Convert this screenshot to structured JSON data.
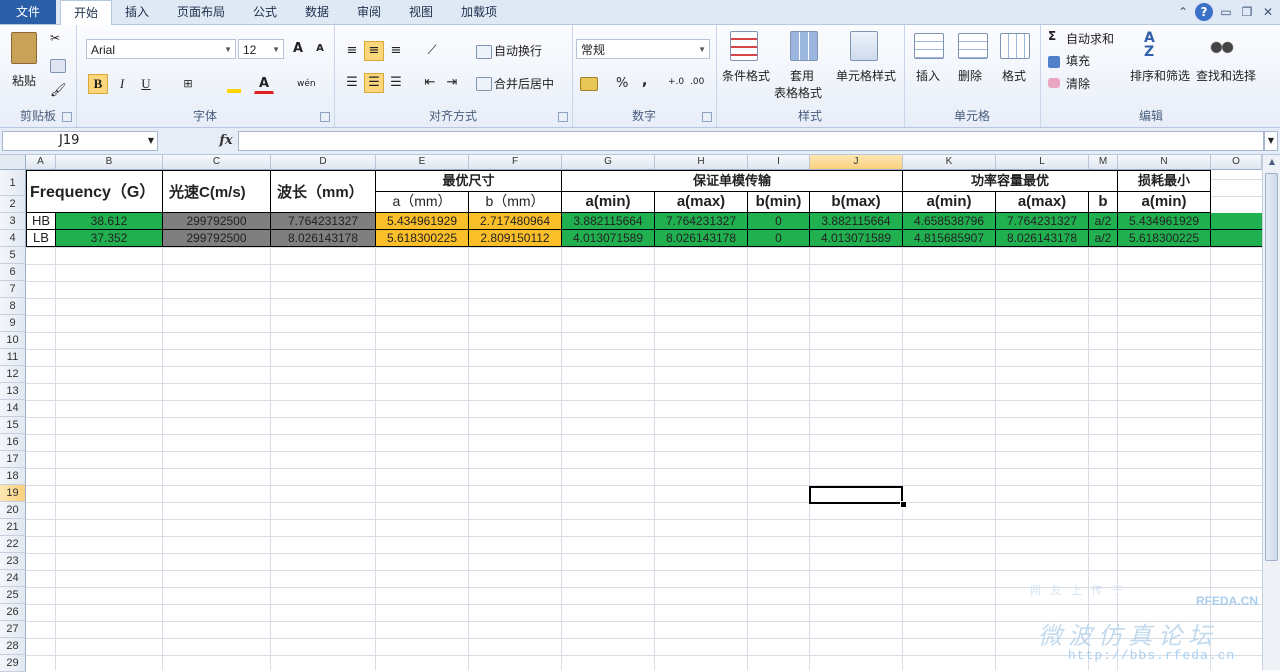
{
  "tabs": [
    "文件",
    "开始",
    "插入",
    "页面布局",
    "公式",
    "数据",
    "审阅",
    "视图",
    "加载项"
  ],
  "ribbon": {
    "clipboard": {
      "paste": "粘贴",
      "label": "剪贴板"
    },
    "font": {
      "name": "Arial",
      "size": "12",
      "label": "字体",
      "bold": "B",
      "italic": "I",
      "underline": "U",
      "grow": "A",
      "shrink": "A",
      "fontcolor": "A",
      "phonetic": "wén"
    },
    "alignment": {
      "wrap": "自动换行",
      "merge": "合并后居中",
      "label": "对齐方式"
    },
    "number": {
      "format": "常规",
      "percent": "%",
      "comma": ",",
      "inc": "+.0",
      "dec": ".00",
      "label": "数字"
    },
    "styles": {
      "conditional": "条件格式",
      "table1": "套用",
      "table2": "表格格式",
      "cell": "单元格样式",
      "label": "样式"
    },
    "cells": {
      "insert": "插入",
      "delete": "删除",
      "format": "格式",
      "label": "单元格"
    },
    "editing": {
      "autosum": "自动求和",
      "fill": "填充",
      "clear": "清除",
      "sort": "排序和筛选",
      "find": "查找和选择",
      "label": "编辑",
      "sigma": "Σ"
    }
  },
  "formula_bar": {
    "name_box": "J19",
    "fx": "fx",
    "content": ""
  },
  "columns": [
    "A",
    "B",
    "C",
    "D",
    "E",
    "F",
    "G",
    "H",
    "I",
    "J",
    "K",
    "L",
    "M",
    "N",
    "O"
  ],
  "selected_column": "J",
  "rows": [
    "1",
    "2",
    "3",
    "4",
    "5",
    "6",
    "7",
    "8",
    "9",
    "10",
    "11",
    "12",
    "13",
    "14",
    "15",
    "16",
    "17",
    "18",
    "19",
    "20",
    "21",
    "22",
    "23",
    "24",
    "25",
    "26",
    "27",
    "28",
    "29"
  ],
  "selected_row": "19",
  "sheet": {
    "frequency_header": "Frequency（G）",
    "c_header": "光速C(m/s)",
    "wavelength_header": "波长（mm）",
    "optimal_size": "最优尺寸",
    "single_mode": "保证单模传输",
    "power_capacity": "功率容量最优",
    "min_loss": "损耗最小",
    "sub": {
      "a_mm": "a（mm）",
      "b_mm": "b（mm）",
      "a_min": "a(min)",
      "a_max": "a(max)",
      "b_min": "b(min)",
      "b_max": "b(max)",
      "b": "b"
    },
    "data_rows": [
      {
        "label": "HB",
        "freq": "38.612",
        "c": "299792500",
        "wavelength": "7.764231327",
        "a": "5.434961929",
        "b": "2.717480964",
        "sm_amin": "3.882115664",
        "sm_amax": "7.764231327",
        "sm_bmin": "0",
        "sm_bmax": "3.882115664",
        "pc_amin": "4.658538796",
        "pc_amax": "7.764231327",
        "pc_b": "a/2",
        "ml_amin": "5.434961929"
      },
      {
        "label": "LB",
        "freq": "37.352",
        "c": "299792500",
        "wavelength": "8.026143178",
        "a": "5.618300225",
        "b": "2.809150112",
        "sm_amin": "4.013071589",
        "sm_amax": "8.026143178",
        "sm_bmin": "0",
        "sm_bmax": "4.013071589",
        "pc_amin": "4.815685907",
        "pc_amax": "8.026143178",
        "pc_b": "a/2",
        "ml_amin": "5.618300225"
      }
    ]
  },
  "watermark": {
    "line1": "网 友 上 传 于",
    "brand": "RFEDA.CN",
    "line2": "微波仿真论坛",
    "url": "http://bbs.rfeda.cn"
  }
}
